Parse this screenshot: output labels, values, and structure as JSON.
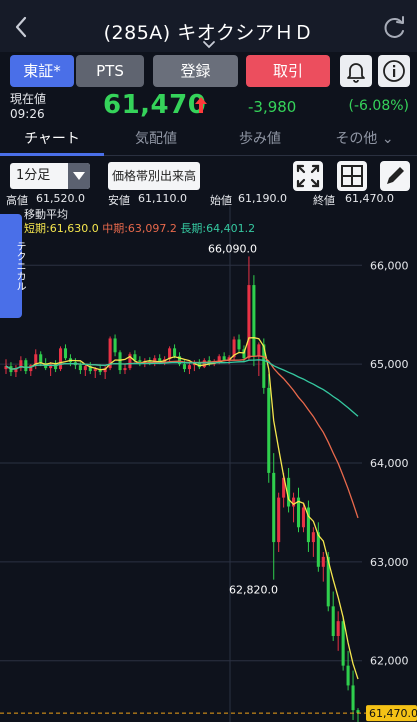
{
  "header": {
    "back_icon": "chevron-left-icon",
    "title": "(285A) キオクシアＨＤ",
    "refresh_icon": "refresh-icon"
  },
  "buttons": {
    "tse": "東証*",
    "pts": "PTS",
    "register": "登録",
    "trade": "取引",
    "bell_icon": "bell-icon",
    "info_icon": "info-icon"
  },
  "quote": {
    "label": "現在値",
    "time": "09:26",
    "price": "61,470",
    "change": "-3,980",
    "change_pct": "(-6.08%)"
  },
  "tabs": [
    {
      "label": "チャート"
    },
    {
      "label": "気配値"
    },
    {
      "label": "歩み値"
    },
    {
      "label": "その他 ⌄"
    }
  ],
  "controls": {
    "interval": "1分足",
    "vp_button": "価格帯別出来高"
  },
  "ohlc": {
    "high_label": "高値",
    "high": "61,520.0",
    "low_label": "安値",
    "low": "61,110.0",
    "open_label": "始値",
    "open": "61,190.0",
    "close_label": "終値",
    "close": "61,470.0"
  },
  "ma": {
    "title": "移動平均",
    "short": "短期:61,630.0",
    "mid": "中期:63,097.2",
    "long": "長期:64,401.2"
  },
  "technical_tab": "テクニカル",
  "colors": {
    "up": "#e83245",
    "down": "#2fcf4d",
    "ma_short": "#f5e64e",
    "ma_mid": "#e8694c",
    "ma_long": "#35c8a0",
    "accent": "#4a6fe8"
  },
  "chart_data": {
    "type": "candlestick",
    "y_axis": [
      "66,000",
      "65,000",
      "64,000",
      "63,000",
      "62,000"
    ],
    "ylim": [
      61380,
      66600
    ],
    "high_annotation": "66,090.0",
    "low_annotation": "62,820.0",
    "current_price_label": "61,470.0",
    "current_price": 61470,
    "candles": [
      [
        64950,
        65050,
        64900,
        64980
      ],
      [
        64980,
        65020,
        64880,
        64920
      ],
      [
        64920,
        64990,
        64870,
        64960
      ],
      [
        64960,
        65080,
        64930,
        65040
      ],
      [
        65040,
        65060,
        64900,
        64930
      ],
      [
        64930,
        65000,
        64880,
        64990
      ],
      [
        64990,
        65150,
        64950,
        65100
      ],
      [
        65100,
        65130,
        64980,
        65010
      ],
      [
        65010,
        65060,
        64940,
        64960
      ],
      [
        64960,
        65020,
        64880,
        65000
      ],
      [
        65000,
        65040,
        64920,
        64950
      ],
      [
        64950,
        65180,
        64930,
        65160
      ],
      [
        65160,
        65200,
        65040,
        65060
      ],
      [
        65060,
        65100,
        64980,
        65020
      ],
      [
        65020,
        65060,
        64950,
        64990
      ],
      [
        64990,
        65020,
        64900,
        64940
      ],
      [
        64940,
        65000,
        64880,
        64980
      ],
      [
        64980,
        65020,
        64900,
        64930
      ],
      [
        64930,
        64970,
        64860,
        64950
      ],
      [
        64950,
        65000,
        64890,
        64920
      ],
      [
        64920,
        64980,
        64850,
        64960
      ],
      [
        64960,
        65280,
        64940,
        65260
      ],
      [
        65260,
        65300,
        65080,
        65120
      ],
      [
        65120,
        65140,
        64900,
        64940
      ],
      [
        64940,
        65000,
        64900,
        64960
      ],
      [
        64960,
        65120,
        64940,
        65100
      ],
      [
        65100,
        65140,
        65020,
        65040
      ],
      [
        65040,
        65080,
        64980,
        65000
      ],
      [
        65000,
        65060,
        64970,
        65030
      ],
      [
        65030,
        65070,
        64990,
        65010
      ],
      [
        65010,
        65090,
        64980,
        65060
      ],
      [
        65060,
        65100,
        65000,
        65020
      ],
      [
        65020,
        65080,
        64990,
        65050
      ],
      [
        65050,
        65180,
        65030,
        65160
      ],
      [
        65160,
        65200,
        65060,
        65080
      ],
      [
        65080,
        65120,
        64980,
        65000
      ],
      [
        65000,
        65040,
        64920,
        64950
      ],
      [
        64950,
        65020,
        64900,
        64990
      ],
      [
        64990,
        65040,
        64930,
        65010
      ],
      [
        65010,
        65050,
        64950,
        64970
      ],
      [
        64970,
        65060,
        64960,
        65040
      ],
      [
        65040,
        65080,
        64980,
        65000
      ],
      [
        65000,
        65050,
        64980,
        65020
      ],
      [
        65020,
        65100,
        65000,
        65080
      ],
      [
        65080,
        65120,
        65030,
        65040
      ],
      [
        65040,
        65090,
        65000,
        65070
      ],
      [
        65070,
        65280,
        65040,
        65250
      ],
      [
        65250,
        65300,
        65120,
        65150
      ],
      [
        65150,
        65190,
        65020,
        65060
      ],
      [
        65060,
        66090,
        65040,
        65800
      ],
      [
        65800,
        65900,
        64980,
        65080
      ],
      [
        65080,
        65220,
        64880,
        65200
      ],
      [
        65200,
        65260,
        64700,
        64760
      ],
      [
        64760,
        64900,
        63800,
        63900
      ],
      [
        63900,
        64100,
        62820,
        63200
      ],
      [
        63200,
        63700,
        63100,
        63650
      ],
      [
        63650,
        63900,
        63550,
        63850
      ],
      [
        63850,
        63950,
        63500,
        63560
      ],
      [
        63560,
        63700,
        63400,
        63650
      ],
      [
        63650,
        63750,
        63300,
        63350
      ],
      [
        63350,
        63600,
        63300,
        63550
      ],
      [
        63550,
        63620,
        63100,
        63200
      ],
      [
        63200,
        63350,
        63050,
        63300
      ],
      [
        63300,
        63400,
        62900,
        62950
      ],
      [
        62950,
        63100,
        62800,
        63050
      ],
      [
        63050,
        63100,
        62500,
        62550
      ],
      [
        62550,
        62700,
        62200,
        62250
      ],
      [
        62250,
        62500,
        62100,
        62400
      ],
      [
        62400,
        62450,
        61900,
        61950
      ],
      [
        61950,
        62100,
        61700,
        61750
      ],
      [
        61750,
        61900,
        61400,
        61500
      ],
      [
        61500,
        61520,
        61110,
        61470
      ]
    ]
  }
}
